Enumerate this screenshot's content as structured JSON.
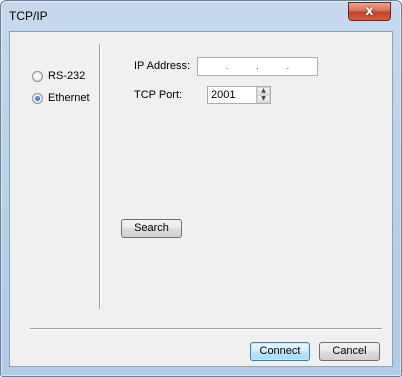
{
  "window": {
    "title": "TCP/IP",
    "close_glyph": "x"
  },
  "connection_type": {
    "options": [
      {
        "label": "RS-232",
        "selected": false
      },
      {
        "label": "Ethernet",
        "selected": true
      }
    ]
  },
  "ethernet": {
    "ip_label": "IP Address:",
    "ip_separators": [
      ".",
      ".",
      "."
    ],
    "ip_value": "",
    "port_label": "TCP Port:",
    "port_value": "2001",
    "spin_up_icon": "arrow-up-icon",
    "spin_down_icon": "arrow-down-icon"
  },
  "buttons": {
    "search": "Search",
    "connect": "Connect",
    "cancel": "Cancel"
  },
  "colors": {
    "title_bar": "#bcd1ea",
    "client_bg": "#f0f0f0",
    "close_button": "#c4402a",
    "default_button_border": "#3c7fb1"
  }
}
